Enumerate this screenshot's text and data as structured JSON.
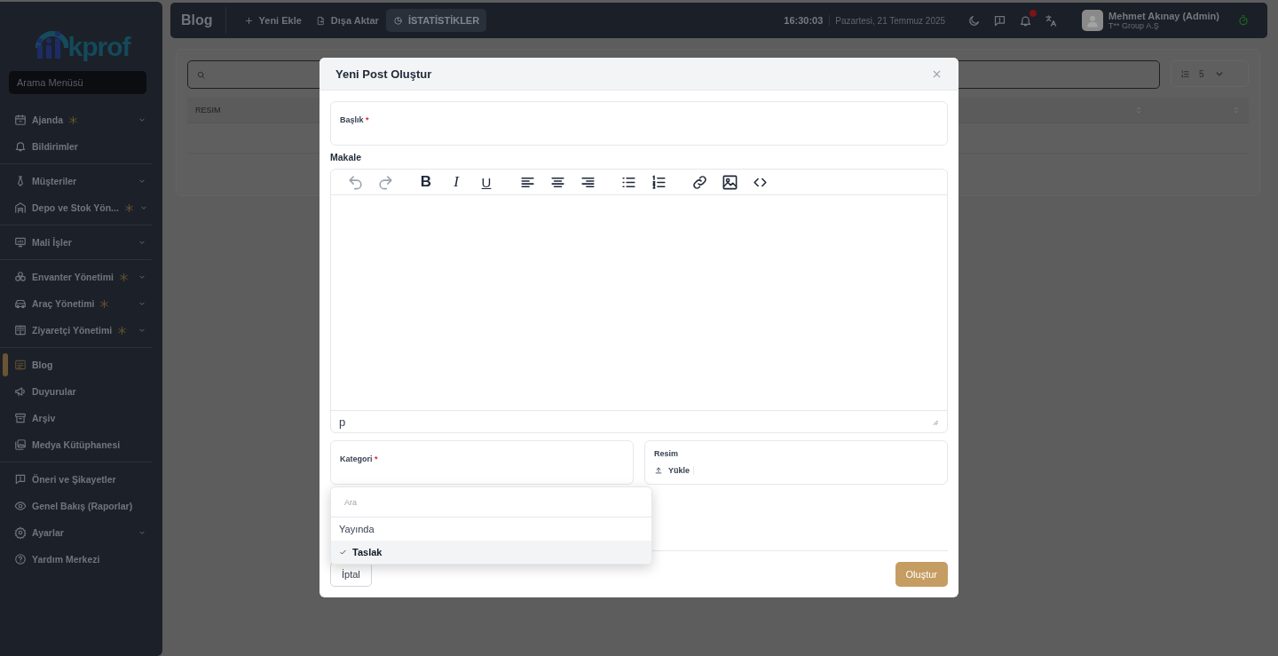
{
  "sidebar": {
    "logo_text": "kprof",
    "search": {
      "placeholder": "Arama Menüsü"
    },
    "groups": [
      [
        {
          "label": "Ajanda",
          "flagged": true,
          "expandable": true,
          "selected": false
        },
        {
          "label": "Bildirimler",
          "flagged": false,
          "expandable": false,
          "selected": false
        }
      ],
      [
        {
          "label": "Müşteriler",
          "flagged": false,
          "expandable": true,
          "selected": false
        },
        {
          "label": "Depo ve Stok Yön...",
          "flagged": true,
          "expandable": true,
          "selected": false
        }
      ],
      [
        {
          "label": "Mali İşler",
          "flagged": false,
          "expandable": true,
          "selected": false
        }
      ],
      [
        {
          "label": "Envanter Yönetimi",
          "flagged": true,
          "expandable": true,
          "selected": false
        },
        {
          "label": "Araç Yönetimi",
          "flagged": true,
          "expandable": true,
          "selected": false
        },
        {
          "label": "Ziyaretçi Yönetimi",
          "flagged": true,
          "expandable": true,
          "selected": false
        }
      ],
      [
        {
          "label": "Blog",
          "flagged": false,
          "expandable": false,
          "selected": true
        },
        {
          "label": "Duyurular",
          "flagged": false,
          "expandable": false,
          "selected": false
        },
        {
          "label": "Arşiv",
          "flagged": false,
          "expandable": false,
          "selected": false
        },
        {
          "label": "Medya Kütüphanesi",
          "flagged": false,
          "expandable": false,
          "selected": false
        }
      ],
      [
        {
          "label": "Öneri ve Şikayetler",
          "flagged": false,
          "expandable": false,
          "selected": false
        },
        {
          "label": "Genel Bakış (Raporlar)",
          "flagged": false,
          "expandable": false,
          "selected": false
        },
        {
          "label": "Ayarlar",
          "flagged": false,
          "expandable": true,
          "selected": false
        },
        {
          "label": "Yardım Merkezi",
          "flagged": false,
          "expandable": false,
          "selected": false
        }
      ]
    ]
  },
  "topbar": {
    "title": "Blog",
    "actions": [
      {
        "kind": "add",
        "label": "Yeni Ekle",
        "selected": false
      },
      {
        "kind": "export",
        "label": "Dışa Aktar",
        "selected": false
      },
      {
        "kind": "stats",
        "label": "İSTATİSTİKLER",
        "selected": true
      }
    ],
    "time": "16:30:03",
    "date": "Pazartesi, 21 Temmuz 2025",
    "has_notification": true,
    "user": {
      "name": "Mehmet Akınay (Admin)",
      "company": "T** Group A.Ş"
    }
  },
  "content": {
    "page_size": "5",
    "table": {
      "columns": [
        "RESIM"
      ]
    }
  },
  "modal": {
    "title": "Yeni Post Oluştur",
    "title_field": {
      "label": "Başlık",
      "required_mark": "*"
    },
    "editor": {
      "label": "Makale",
      "status": "p",
      "toolbar": [
        [
          {
            "kind": "undo"
          },
          {
            "kind": "redo"
          }
        ],
        [
          {
            "kind": "bold",
            "label": "B"
          },
          {
            "kind": "italic",
            "label": "I"
          },
          {
            "kind": "underline",
            "label": "U"
          }
        ],
        [
          {
            "kind": "align-left"
          },
          {
            "kind": "align-center"
          },
          {
            "kind": "align-right"
          }
        ],
        [
          {
            "kind": "bullet-list"
          },
          {
            "kind": "numbered-list"
          }
        ],
        [
          {
            "kind": "link"
          },
          {
            "kind": "image"
          },
          {
            "kind": "code"
          }
        ]
      ]
    },
    "category_field": {
      "label": "Kategori",
      "required_mark": "*"
    },
    "image_field": {
      "label": "Resim",
      "upload": "Yükle"
    },
    "dropdown": {
      "placeholder": "Ara",
      "options": [
        {
          "label": "Yayında",
          "selected": false
        },
        {
          "label": "Taslak",
          "selected": true
        }
      ]
    },
    "buttons": [
      {
        "kind": "cancel",
        "label": "İptal"
      },
      {
        "kind": "primary",
        "label": "Oluştur"
      }
    ]
  }
}
